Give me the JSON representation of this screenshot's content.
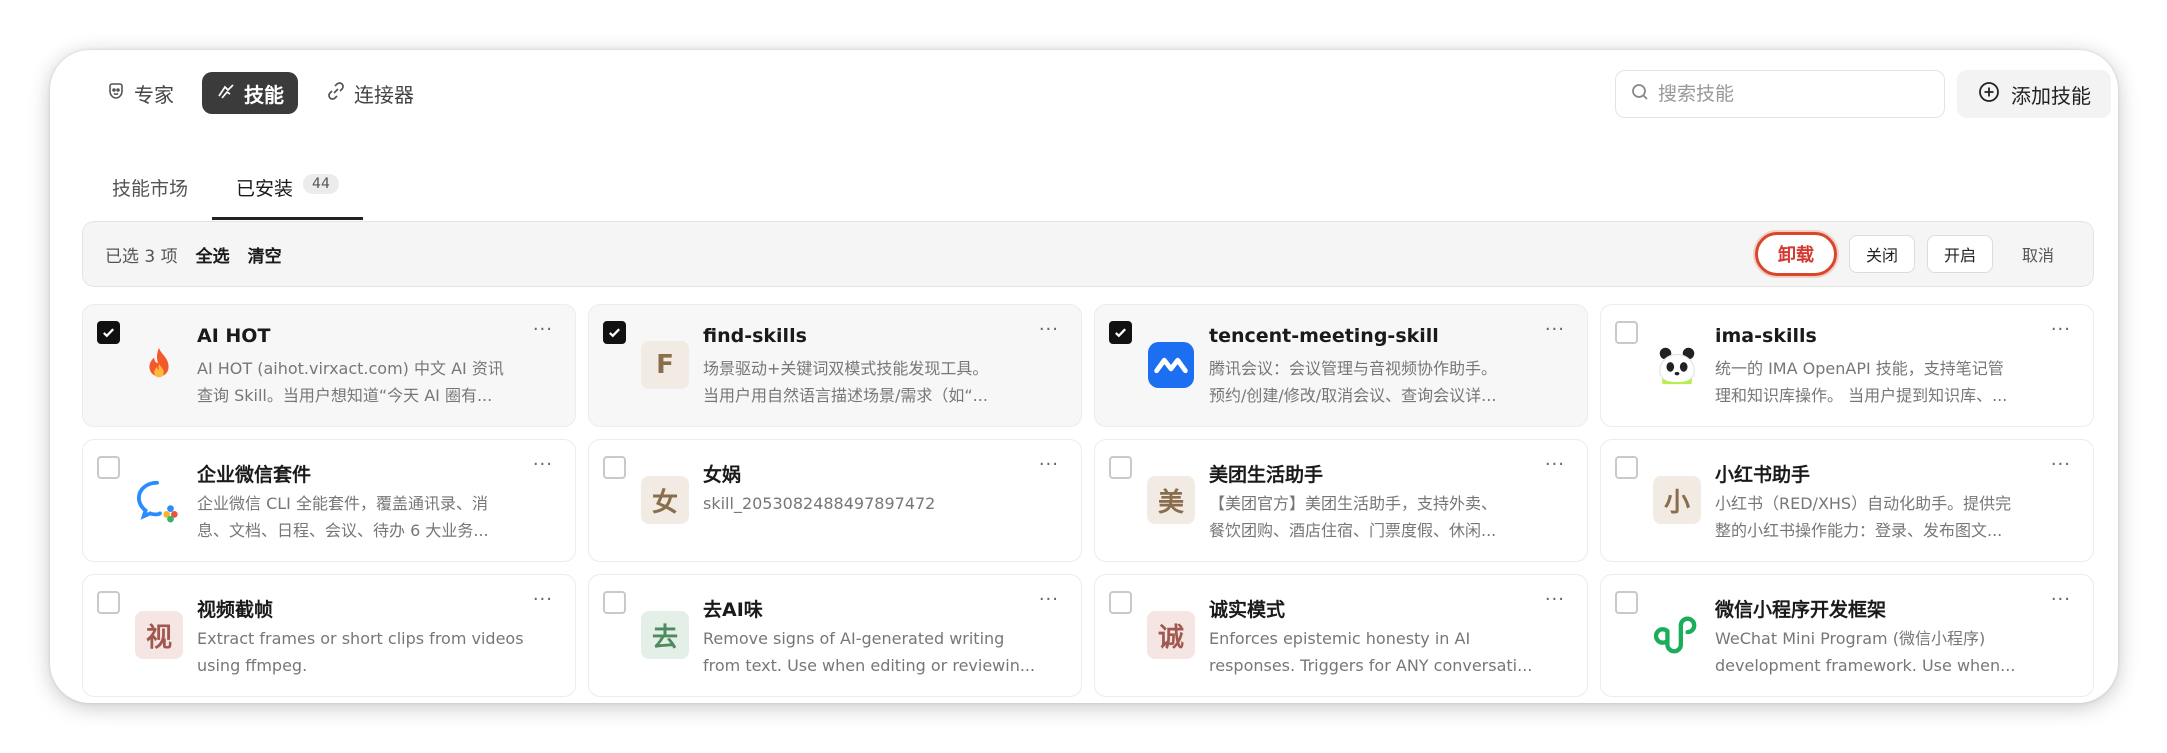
{
  "nav": {
    "items": [
      {
        "label": "专家",
        "icon": "expert-face-icon",
        "active": false
      },
      {
        "label": "技能",
        "icon": "skill-hand-icon",
        "active": true
      },
      {
        "label": "连接器",
        "icon": "link-icon",
        "active": false
      }
    ],
    "search": {
      "placeholder": "搜索技能",
      "value": ""
    },
    "add_label": "添加技能"
  },
  "tabs": [
    {
      "label": "技能市场",
      "active": false
    },
    {
      "label": "已安装",
      "active": true,
      "count": "44"
    }
  ],
  "selection": {
    "count_text": "已选 3 项",
    "select_all": "全选",
    "clear": "清空",
    "uninstall": "卸载",
    "disable": "关闭",
    "enable": "开启",
    "cancel": "取消"
  },
  "accent": "#d9472b",
  "skills": [
    {
      "name": "AI HOT",
      "checked": true,
      "icon": "fire-icon",
      "desc": [
        "AI HOT (aihot.virxact.com) 中文 AI 资讯",
        "查询 Skill。当用户想知道“今天 AI 圈有..."
      ]
    },
    {
      "name": "find-skills",
      "checked": true,
      "icon": "letter-f-icon",
      "letter": "F",
      "icon_bg": "#f1ebe3",
      "icon_fg": "#8a6d4c",
      "desc": [
        "场景驱动+关键词双模式技能发现工具。",
        "当用户用自然语言描述场景/需求（如“..."
      ]
    },
    {
      "name": "tencent-meeting-skill",
      "checked": true,
      "icon": "tencent-meeting-icon",
      "desc": [
        "腾讯会议：会议管理与音视频协作助手。",
        "预约/创建/修改/取消会议、查询会议详..."
      ]
    },
    {
      "name": "ima-skills",
      "checked": false,
      "icon": "panda-icon",
      "desc": [
        "统一的 IMA OpenAPI 技能，支持笔记管",
        "理和知识库操作。 当用户提到知识库、..."
      ]
    },
    {
      "name": "企业微信套件",
      "checked": false,
      "icon": "wecom-icon",
      "desc": [
        "企业微信 CLI 全能套件，覆盖通讯录、消",
        "息、文档、日程、会议、待办 6 大业务..."
      ]
    },
    {
      "name": "女娲",
      "checked": false,
      "icon": "letter-nv-icon",
      "letter": "女",
      "icon_bg": "#f1ebe3",
      "icon_fg": "#8a6d4c",
      "desc": [
        "skill_2053082488497897472"
      ]
    },
    {
      "name": "美团生活助手",
      "checked": false,
      "icon": "letter-mei-icon",
      "letter": "美",
      "icon_bg": "#f1ebe3",
      "icon_fg": "#8a6d4c",
      "desc": [
        "【美团官方】美团生活助手，支持外卖、",
        "餐饮团购、酒店住宿、门票度假、休闲..."
      ]
    },
    {
      "name": "小红书助手",
      "checked": false,
      "icon": "letter-xiao-icon",
      "letter": "小",
      "icon_bg": "#f1ebe3",
      "icon_fg": "#8a6d4c",
      "desc": [
        "小红书（RED/XHS）自动化助手。提供完",
        "整的小红书操作能力：登录、发布图文..."
      ]
    },
    {
      "name": "视频截帧",
      "checked": false,
      "icon": "letter-shi-icon",
      "letter": "视",
      "icon_bg": "#f5e6e4",
      "icon_fg": "#a0584f",
      "desc": [
        "Extract frames or short clips from videos",
        "using ffmpeg."
      ]
    },
    {
      "name": "去AI味",
      "checked": false,
      "icon": "letter-qu-icon",
      "letter": "去",
      "icon_bg": "#e4efe7",
      "icon_fg": "#4f8a5e",
      "desc": [
        "Remove signs of AI-generated writing",
        "from text. Use when editing or reviewin..."
      ]
    },
    {
      "name": "诚实模式",
      "checked": false,
      "icon": "letter-cheng-icon",
      "letter": "诚",
      "icon_bg": "#f5e6e4",
      "icon_fg": "#a0584f",
      "desc": [
        "Enforces epistemic honesty in AI",
        "responses. Triggers for ANY conversati..."
      ]
    },
    {
      "name": "微信小程序开发框架",
      "checked": false,
      "icon": "wechat-miniprogram-icon",
      "desc": [
        "WeChat Mini Program (微信小程序)",
        "development framework. Use when..."
      ]
    }
  ],
  "more_label": "···"
}
